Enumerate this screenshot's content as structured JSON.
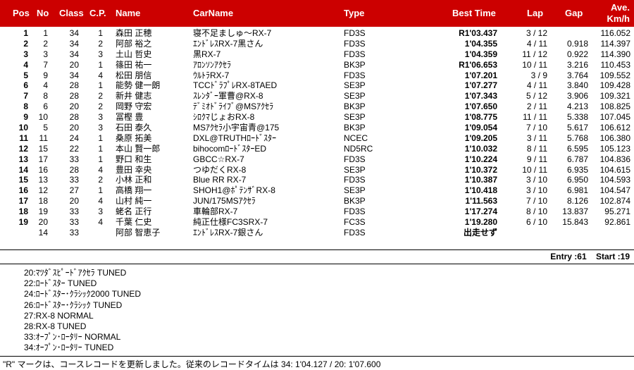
{
  "header": {
    "pos": "Pos",
    "no": "No",
    "class": "Class",
    "cp": "C.P.",
    "name": "Name",
    "car": "CarName",
    "type": "Type",
    "best": "Best Time",
    "lap": "Lap",
    "gap": "Gap",
    "ave1": "Ave.",
    "ave2": "Km/h"
  },
  "rows": [
    {
      "pos": "1",
      "no": "1",
      "class": "34",
      "cp": "1",
      "name": "森田 正穂",
      "car": "寝不足ましゅ～RX-7",
      "type": "FD3S",
      "best": "R1'03.437",
      "lap": "3 / 12",
      "gap": "",
      "ave": "116.052"
    },
    {
      "pos": "2",
      "no": "2",
      "class": "34",
      "cp": "2",
      "name": "阿部 裕之",
      "car": "ｴﾝﾄﾞﾚｽRX-7黒さん",
      "type": "FD3S",
      "best": "1'04.355",
      "lap": "4 / 11",
      "gap": "0.918",
      "ave": "114.397"
    },
    {
      "pos": "3",
      "no": "3",
      "class": "34",
      "cp": "3",
      "name": "土山 哲史",
      "car": "黒RX-7",
      "type": "FD3S",
      "best": "1'04.359",
      "lap": "11 / 12",
      "gap": "0.922",
      "ave": "114.390"
    },
    {
      "pos": "4",
      "no": "7",
      "class": "20",
      "cp": "1",
      "name": "篠田 祐一",
      "car": "ｱﾛﾝｿﾝｱｸｾﾗ",
      "type": "BK3P",
      "best": "R1'06.653",
      "lap": "10 / 11",
      "gap": "3.216",
      "ave": "110.453"
    },
    {
      "pos": "5",
      "no": "9",
      "class": "34",
      "cp": "4",
      "name": "松田 朋信",
      "car": "ｳﾙﾄﾗRX-7",
      "type": "FD3S",
      "best": "1'07.201",
      "lap": "3 / 9",
      "gap": "3.764",
      "ave": "109.552"
    },
    {
      "pos": "6",
      "no": "4",
      "class": "28",
      "cp": "1",
      "name": "能勢 健一朗",
      "car": "TCCﾄﾞﾗﾌﾟﾚRX-8TAED",
      "type": "SE3P",
      "best": "1'07.277",
      "lap": "4 / 11",
      "gap": "3.840",
      "ave": "109.428"
    },
    {
      "pos": "7",
      "no": "8",
      "class": "28",
      "cp": "2",
      "name": "新井 健志",
      "car": "ｽﾚﾝﾀﾞｰ軍曹@RX-8",
      "type": "SE3P",
      "best": "1'07.343",
      "lap": "5 / 12",
      "gap": "3.906",
      "ave": "109.321"
    },
    {
      "pos": "8",
      "no": "6",
      "class": "20",
      "cp": "2",
      "name": "岡野 守宏",
      "car": "ﾃﾞﾐｵﾄﾞﾗｲﾌﾞ@MSｱｸｾﾗ",
      "type": "BK3P",
      "best": "1'07.650",
      "lap": "2 / 11",
      "gap": "4.213",
      "ave": "108.825"
    },
    {
      "pos": "9",
      "no": "10",
      "class": "28",
      "cp": "3",
      "name": "冨樫 豊",
      "car": "ｼﾛｸﾏじょおRX-8",
      "type": "SE3P",
      "best": "1'08.775",
      "lap": "11 / 11",
      "gap": "5.338",
      "ave": "107.045"
    },
    {
      "pos": "10",
      "no": "5",
      "class": "20",
      "cp": "3",
      "name": "石田 泰久",
      "car": "MSｱｸｾﾗ小宇宙青@175",
      "type": "BK3P",
      "best": "1'09.054",
      "lap": "7 / 10",
      "gap": "5.617",
      "ave": "106.612"
    },
    {
      "pos": "11",
      "no": "11",
      "class": "24",
      "cp": "1",
      "name": "桑原 拓美",
      "car": "DXL@TRUTHﾛｰﾄﾞｽﾀｰ",
      "type": "NCEC",
      "best": "1'09.205",
      "lap": "3 / 11",
      "gap": "5.768",
      "ave": "106.380"
    },
    {
      "pos": "12",
      "no": "15",
      "class": "22",
      "cp": "1",
      "name": "本山 賢一郎",
      "car": "bihocomﾛｰﾄﾞｽﾀｰED",
      "type": "ND5RC",
      "best": "1'10.032",
      "lap": "8 / 11",
      "gap": "6.595",
      "ave": "105.123"
    },
    {
      "pos": "13",
      "no": "17",
      "class": "33",
      "cp": "1",
      "name": "野口 和生",
      "car": "GBCC☆RX-7",
      "type": "FD3S",
      "best": "1'10.224",
      "lap": "9 / 11",
      "gap": "6.787",
      "ave": "104.836"
    },
    {
      "pos": "14",
      "no": "16",
      "class": "28",
      "cp": "4",
      "name": "豊田 幸央",
      "car": "つゆだくRX-8",
      "type": "SE3P",
      "best": "1'10.372",
      "lap": "10 / 11",
      "gap": "6.935",
      "ave": "104.615"
    },
    {
      "pos": "15",
      "no": "13",
      "class": "33",
      "cp": "2",
      "name": "小林 正和",
      "car": "Blue RR RX-7",
      "type": "FD3S",
      "best": "1'10.387",
      "lap": "3 / 10",
      "gap": "6.950",
      "ave": "104.593"
    },
    {
      "pos": "16",
      "no": "12",
      "class": "27",
      "cp": "1",
      "name": "高橋 翔一",
      "car": "SHOH1@ﾎﾟﾃﾝｻﾞRX-8",
      "type": "SE3P",
      "best": "1'10.418",
      "lap": "3 / 10",
      "gap": "6.981",
      "ave": "104.547"
    },
    {
      "pos": "17",
      "no": "18",
      "class": "20",
      "cp": "4",
      "name": "山村 純一",
      "car": "JUN/175MSｱｸｾﾗ",
      "type": "BK3P",
      "best": "1'11.563",
      "lap": "7 / 10",
      "gap": "8.126",
      "ave": "102.874"
    },
    {
      "pos": "18",
      "no": "19",
      "class": "33",
      "cp": "3",
      "name": "蛯名 正行",
      "car": "車輪部RX-7",
      "type": "FD3S",
      "best": "1'17.274",
      "lap": "8 / 10",
      "gap": "13.837",
      "ave": "95.271"
    },
    {
      "pos": "19",
      "no": "20",
      "class": "33",
      "cp": "4",
      "name": "千葉 仁史",
      "car": "純正仕様FC3SRX-7",
      "type": "FC3S",
      "best": "1'19.280",
      "lap": "6 / 10",
      "gap": "15.843",
      "ave": "92.861"
    },
    {
      "pos": "",
      "no": "14",
      "class": "33",
      "cp": "",
      "name": "阿部 智恵子",
      "car": "ｴﾝﾄﾞﾚｽRX-7銀さん",
      "type": "FD3S",
      "best": "出走せず",
      "lap": "",
      "gap": "",
      "ave": ""
    }
  ],
  "entry": {
    "entry": "Entry :61",
    "start": "Start :19"
  },
  "legend": [
    "20:ﾏﾂﾀﾞｽﾋﾟｰﾄﾞｱｸｾﾗ TUNED",
    "22:ﾛｰﾄﾞｽﾀｰ TUNED",
    "24:ﾛｰﾄﾞｽﾀｰ･ｸﾗｼｯｸ2000 TUNED",
    "26:ﾛｰﾄﾞｽﾀｰ･ｸﾗｼｯｸ TUNED",
    "27:RX-8 NORMAL",
    "28:RX-8 TUNED",
    "33:ｵｰﾌﾟﾝ･ﾛｰﾀﾘｰ NORMAL",
    "34:ｵｰﾌﾟﾝ･ﾛｰﾀﾘｰ TUNED"
  ],
  "note": "\"R\" マークは、コースレコードを更新しました。従来のレコードタイムは 34: 1'04.127 / 20: 1'07.600"
}
